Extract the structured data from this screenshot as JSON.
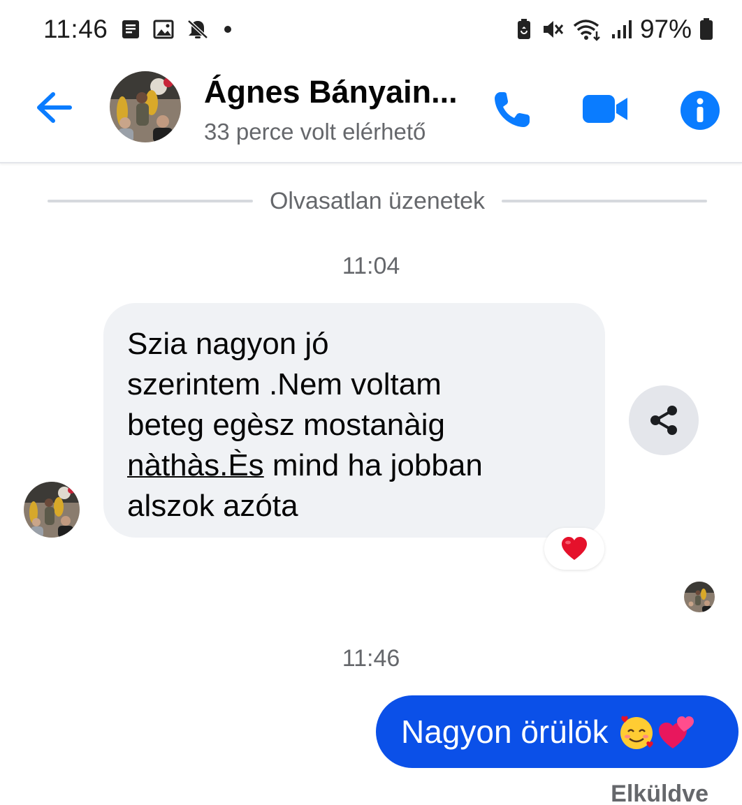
{
  "statusbar": {
    "time": "11:46",
    "battery": "97%",
    "icons_left": [
      "notes-icon",
      "gallery-icon",
      "bell-off-icon",
      "dot-icon"
    ],
    "icons_right": [
      "battery-saver-icon",
      "mute-icon",
      "wifi-icon",
      "signal-icon",
      "battery-icon"
    ]
  },
  "header": {
    "name": "Ágnes Bányain...",
    "status": "33 perce volt elérhető",
    "accent": "#0a7cff"
  },
  "divider": {
    "label": "Olvasatlan üzenetek"
  },
  "messages": [
    {
      "time": "11:04",
      "direction": "incoming",
      "lines": [
        "Szia nagyon jó",
        "szerintem .Nem voltam",
        "beteg egèsz mostanàig"
      ],
      "line4_link": "nàthàs.Ès",
      "line4_rest": " mind ha jobban",
      "line5": "alszok azóta",
      "reaction": "❤️"
    },
    {
      "time": "11:46",
      "direction": "outgoing",
      "text": "Nagyon örülök",
      "status": "Elküldve",
      "bubble_color": "#0b50e8"
    }
  ]
}
